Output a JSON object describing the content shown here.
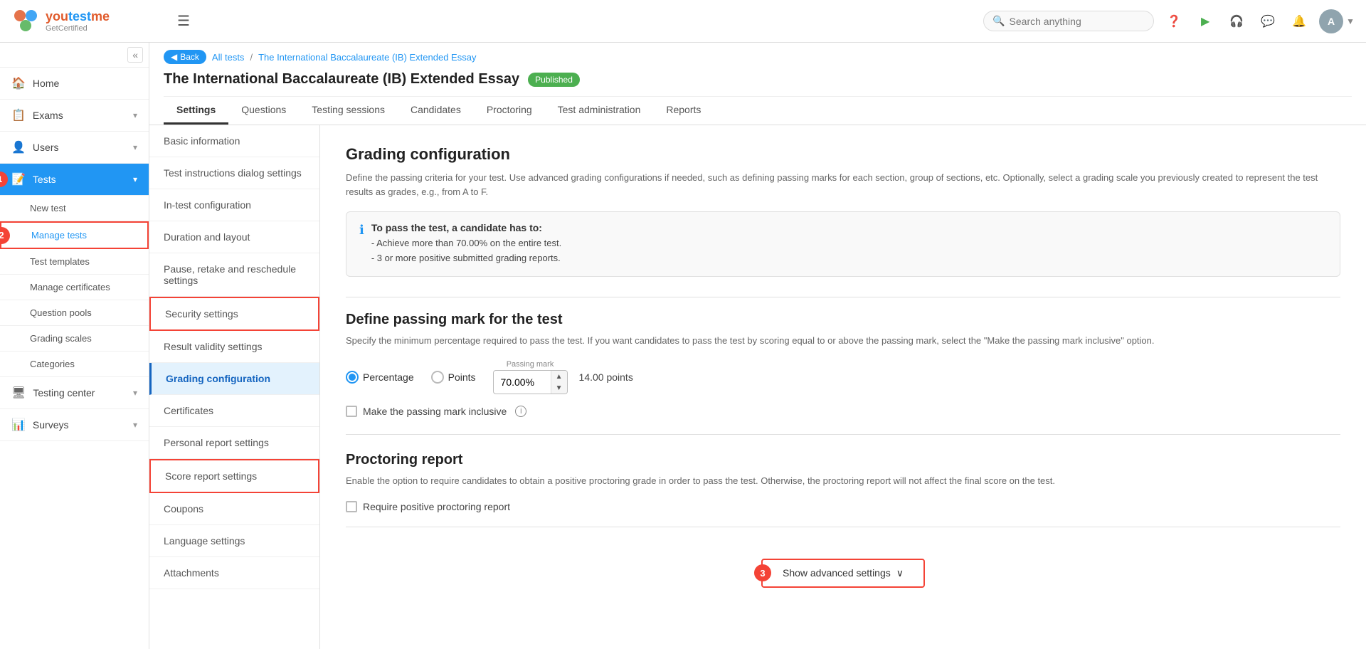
{
  "app": {
    "logo_you": "you",
    "logo_test": "test",
    "logo_me": "me",
    "logo_sub": "GetCertified"
  },
  "header": {
    "search_placeholder": "Search anything",
    "back_label": "Back",
    "breadcrumb_all_tests": "All tests",
    "breadcrumb_sep": "/",
    "breadcrumb_current": "The International Baccalaureate (IB) Extended Essay",
    "page_title": "The International Baccalaureate (IB) Extended Essay",
    "published_label": "Published"
  },
  "tabs": [
    {
      "label": "Settings",
      "active": true
    },
    {
      "label": "Questions",
      "active": false
    },
    {
      "label": "Testing sessions",
      "active": false
    },
    {
      "label": "Candidates",
      "active": false
    },
    {
      "label": "Proctoring",
      "active": false
    },
    {
      "label": "Test administration",
      "active": false
    },
    {
      "label": "Reports",
      "active": false
    }
  ],
  "sidebar": {
    "collapse_icon": "«",
    "items": [
      {
        "label": "Home",
        "icon": "🏠",
        "active": false
      },
      {
        "label": "Exams",
        "icon": "📋",
        "active": false,
        "has_arrow": true
      },
      {
        "label": "Users",
        "icon": "👤",
        "active": false,
        "has_arrow": true
      },
      {
        "label": "Tests",
        "icon": "📝",
        "active": true,
        "has_arrow": true,
        "badge": "1"
      }
    ],
    "sub_items": [
      {
        "label": "New test",
        "active": false
      },
      {
        "label": "Manage tests",
        "active": false,
        "highlighted": true,
        "badge": "2"
      },
      {
        "label": "Test templates",
        "active": false
      },
      {
        "label": "Manage certificates",
        "active": false
      },
      {
        "label": "Question pools",
        "active": false
      },
      {
        "label": "Grading scales",
        "active": false
      },
      {
        "label": "Categories",
        "active": false
      }
    ],
    "bottom_items": [
      {
        "label": "Testing center",
        "icon": "🖥",
        "active": false,
        "has_arrow": true
      },
      {
        "label": "Surveys",
        "icon": "📊",
        "active": false,
        "has_arrow": true
      }
    ]
  },
  "settings_menu": {
    "items": [
      {
        "label": "Basic information",
        "active": false
      },
      {
        "label": "Test instructions dialog settings",
        "active": false
      },
      {
        "label": "In-test configuration",
        "active": false
      },
      {
        "label": "Duration and layout",
        "active": false,
        "highlighted": false
      },
      {
        "label": "Pause, retake and reschedule settings",
        "active": false
      },
      {
        "label": "Security settings",
        "active": false,
        "highlighted": false
      },
      {
        "label": "Result validity settings",
        "active": false
      },
      {
        "label": "Grading configuration",
        "active": true
      },
      {
        "label": "Certificates",
        "active": false
      },
      {
        "label": "Personal report settings",
        "active": false
      },
      {
        "label": "Score report settings",
        "active": false
      },
      {
        "label": "Coupons",
        "active": false
      },
      {
        "label": "Language settings",
        "active": false
      },
      {
        "label": "Attachments",
        "active": false
      }
    ]
  },
  "grading_config": {
    "title": "Grading configuration",
    "description": "Define the passing criteria for your test. Use advanced grading configurations if needed, such as defining passing marks for each section, group of sections, etc. Optionally, select a grading scale you previously created to represent the test results as grades, e.g., from A to F.",
    "info_box": {
      "title": "To pass the test, a candidate has to:",
      "line1": "- Achieve more than 70.00% on the entire test.",
      "line2": "- 3 or more positive submitted grading reports."
    }
  },
  "passing_mark": {
    "title": "Define passing mark for the test",
    "description": "Specify the minimum percentage required to pass the test. If you want candidates to pass the test by scoring equal to or above the passing mark, select the \"Make the passing mark inclusive\" option.",
    "options": [
      {
        "label": "Percentage",
        "selected": true
      },
      {
        "label": "Points",
        "selected": false
      }
    ],
    "passing_mark_label": "Passing mark",
    "value": "70.00%",
    "points_label": "14.00 points",
    "inclusive_label": "Make the passing mark inclusive",
    "inclusive_info": "ⓘ"
  },
  "proctoring": {
    "title": "Proctoring report",
    "description": "Enable the option to require candidates to obtain a positive proctoring grade in order to pass the test. Otherwise, the proctoring report will not affect the final score on the test.",
    "checkbox_label": "Require positive proctoring report"
  },
  "advanced": {
    "show_label": "Show advanced settings",
    "chevron": "∨",
    "badge": "3"
  }
}
